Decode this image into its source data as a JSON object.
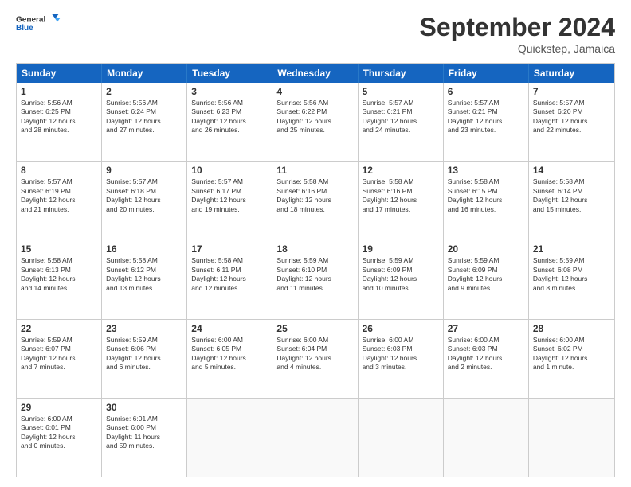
{
  "logo": {
    "line1": "General",
    "line2": "Blue"
  },
  "title": "September 2024",
  "subtitle": "Quickstep, Jamaica",
  "header_days": [
    "Sunday",
    "Monday",
    "Tuesday",
    "Wednesday",
    "Thursday",
    "Friday",
    "Saturday"
  ],
  "rows": [
    [
      {
        "day": "1",
        "lines": [
          "Sunrise: 5:56 AM",
          "Sunset: 6:25 PM",
          "Daylight: 12 hours",
          "and 28 minutes."
        ]
      },
      {
        "day": "2",
        "lines": [
          "Sunrise: 5:56 AM",
          "Sunset: 6:24 PM",
          "Daylight: 12 hours",
          "and 27 minutes."
        ]
      },
      {
        "day": "3",
        "lines": [
          "Sunrise: 5:56 AM",
          "Sunset: 6:23 PM",
          "Daylight: 12 hours",
          "and 26 minutes."
        ]
      },
      {
        "day": "4",
        "lines": [
          "Sunrise: 5:56 AM",
          "Sunset: 6:22 PM",
          "Daylight: 12 hours",
          "and 25 minutes."
        ]
      },
      {
        "day": "5",
        "lines": [
          "Sunrise: 5:57 AM",
          "Sunset: 6:21 PM",
          "Daylight: 12 hours",
          "and 24 minutes."
        ]
      },
      {
        "day": "6",
        "lines": [
          "Sunrise: 5:57 AM",
          "Sunset: 6:21 PM",
          "Daylight: 12 hours",
          "and 23 minutes."
        ]
      },
      {
        "day": "7",
        "lines": [
          "Sunrise: 5:57 AM",
          "Sunset: 6:20 PM",
          "Daylight: 12 hours",
          "and 22 minutes."
        ]
      }
    ],
    [
      {
        "day": "8",
        "lines": [
          "Sunrise: 5:57 AM",
          "Sunset: 6:19 PM",
          "Daylight: 12 hours",
          "and 21 minutes."
        ]
      },
      {
        "day": "9",
        "lines": [
          "Sunrise: 5:57 AM",
          "Sunset: 6:18 PM",
          "Daylight: 12 hours",
          "and 20 minutes."
        ]
      },
      {
        "day": "10",
        "lines": [
          "Sunrise: 5:57 AM",
          "Sunset: 6:17 PM",
          "Daylight: 12 hours",
          "and 19 minutes."
        ]
      },
      {
        "day": "11",
        "lines": [
          "Sunrise: 5:58 AM",
          "Sunset: 6:16 PM",
          "Daylight: 12 hours",
          "and 18 minutes."
        ]
      },
      {
        "day": "12",
        "lines": [
          "Sunrise: 5:58 AM",
          "Sunset: 6:16 PM",
          "Daylight: 12 hours",
          "and 17 minutes."
        ]
      },
      {
        "day": "13",
        "lines": [
          "Sunrise: 5:58 AM",
          "Sunset: 6:15 PM",
          "Daylight: 12 hours",
          "and 16 minutes."
        ]
      },
      {
        "day": "14",
        "lines": [
          "Sunrise: 5:58 AM",
          "Sunset: 6:14 PM",
          "Daylight: 12 hours",
          "and 15 minutes."
        ]
      }
    ],
    [
      {
        "day": "15",
        "lines": [
          "Sunrise: 5:58 AM",
          "Sunset: 6:13 PM",
          "Daylight: 12 hours",
          "and 14 minutes."
        ]
      },
      {
        "day": "16",
        "lines": [
          "Sunrise: 5:58 AM",
          "Sunset: 6:12 PM",
          "Daylight: 12 hours",
          "and 13 minutes."
        ]
      },
      {
        "day": "17",
        "lines": [
          "Sunrise: 5:58 AM",
          "Sunset: 6:11 PM",
          "Daylight: 12 hours",
          "and 12 minutes."
        ]
      },
      {
        "day": "18",
        "lines": [
          "Sunrise: 5:59 AM",
          "Sunset: 6:10 PM",
          "Daylight: 12 hours",
          "and 11 minutes."
        ]
      },
      {
        "day": "19",
        "lines": [
          "Sunrise: 5:59 AM",
          "Sunset: 6:09 PM",
          "Daylight: 12 hours",
          "and 10 minutes."
        ]
      },
      {
        "day": "20",
        "lines": [
          "Sunrise: 5:59 AM",
          "Sunset: 6:09 PM",
          "Daylight: 12 hours",
          "and 9 minutes."
        ]
      },
      {
        "day": "21",
        "lines": [
          "Sunrise: 5:59 AM",
          "Sunset: 6:08 PM",
          "Daylight: 12 hours",
          "and 8 minutes."
        ]
      }
    ],
    [
      {
        "day": "22",
        "lines": [
          "Sunrise: 5:59 AM",
          "Sunset: 6:07 PM",
          "Daylight: 12 hours",
          "and 7 minutes."
        ]
      },
      {
        "day": "23",
        "lines": [
          "Sunrise: 5:59 AM",
          "Sunset: 6:06 PM",
          "Daylight: 12 hours",
          "and 6 minutes."
        ]
      },
      {
        "day": "24",
        "lines": [
          "Sunrise: 6:00 AM",
          "Sunset: 6:05 PM",
          "Daylight: 12 hours",
          "and 5 minutes."
        ]
      },
      {
        "day": "25",
        "lines": [
          "Sunrise: 6:00 AM",
          "Sunset: 6:04 PM",
          "Daylight: 12 hours",
          "and 4 minutes."
        ]
      },
      {
        "day": "26",
        "lines": [
          "Sunrise: 6:00 AM",
          "Sunset: 6:03 PM",
          "Daylight: 12 hours",
          "and 3 minutes."
        ]
      },
      {
        "day": "27",
        "lines": [
          "Sunrise: 6:00 AM",
          "Sunset: 6:03 PM",
          "Daylight: 12 hours",
          "and 2 minutes."
        ]
      },
      {
        "day": "28",
        "lines": [
          "Sunrise: 6:00 AM",
          "Sunset: 6:02 PM",
          "Daylight: 12 hours",
          "and 1 minute."
        ]
      }
    ],
    [
      {
        "day": "29",
        "lines": [
          "Sunrise: 6:00 AM",
          "Sunset: 6:01 PM",
          "Daylight: 12 hours",
          "and 0 minutes."
        ]
      },
      {
        "day": "30",
        "lines": [
          "Sunrise: 6:01 AM",
          "Sunset: 6:00 PM",
          "Daylight: 11 hours",
          "and 59 minutes."
        ]
      },
      {
        "day": "",
        "lines": []
      },
      {
        "day": "",
        "lines": []
      },
      {
        "day": "",
        "lines": []
      },
      {
        "day": "",
        "lines": []
      },
      {
        "day": "",
        "lines": []
      }
    ]
  ]
}
